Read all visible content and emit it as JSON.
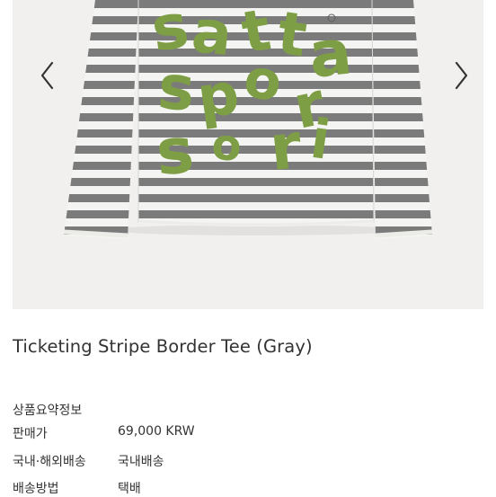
{
  "gallery": {
    "prev_label": "Previous image",
    "next_label": "Next image",
    "graphic_lettering": "satta sports"
  },
  "product": {
    "title": "Ticketing Stripe Border Tee (Gray)"
  },
  "summary": {
    "heading": "상품요약정보",
    "rows": [
      {
        "label": "판매가",
        "value": "69,000 KRW"
      },
      {
        "label": "국내·해외배송",
        "value": "국내배송"
      },
      {
        "label": "배송방법",
        "value": "택배"
      }
    ]
  },
  "colors": {
    "stripe_gray": "#7b7b7b",
    "stripe_white": "#f4f4f2",
    "print_green": "#7d9e45",
    "background": "#f1f0ef"
  }
}
